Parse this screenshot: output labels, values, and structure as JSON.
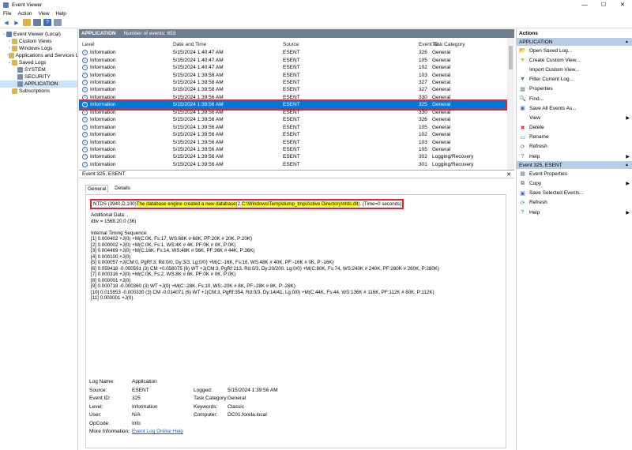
{
  "window": {
    "title": "Event Viewer",
    "controls": [
      "—",
      "☐",
      "✕"
    ]
  },
  "menu": [
    "File",
    "Action",
    "View",
    "Help"
  ],
  "tree": [
    {
      "label": "Event Viewer (Local)",
      "level": 0,
      "arrow": "⌄",
      "color": "#5a7fb5"
    },
    {
      "label": "Custom Views",
      "level": 1,
      "arrow": "›",
      "color": "#d8b44a"
    },
    {
      "label": "Windows Logs",
      "level": 1,
      "arrow": "›",
      "color": "#d8b44a"
    },
    {
      "label": "Applications and Services Lo",
      "level": 1,
      "arrow": "›",
      "color": "#d8b44a"
    },
    {
      "label": "Saved Logs",
      "level": 1,
      "arrow": "⌄",
      "color": "#d8b44a"
    },
    {
      "label": "SYSTEM",
      "level": 2,
      "arrow": "",
      "color": "#7a8fa6"
    },
    {
      "label": "SECURITY",
      "level": 2,
      "arrow": "",
      "color": "#7a8fa6"
    },
    {
      "label": "APPLICATION",
      "level": 2,
      "arrow": "",
      "color": "#7a8fa6",
      "selected": true
    },
    {
      "label": "Subscriptions",
      "level": 1,
      "arrow": "",
      "color": "#d8b44a"
    }
  ],
  "log": {
    "name": "APPLICATION",
    "count": "Number of events: 653"
  },
  "columns": {
    "level": "Level",
    "date": "Date and Time",
    "source": "Source",
    "id": "Event ID",
    "category": "Task Category"
  },
  "events": [
    {
      "level": "Information",
      "date": "5/15/2024 1:40:47 AM",
      "source": "ESENT",
      "id": "326",
      "category": "General"
    },
    {
      "level": "Information",
      "date": "5/15/2024 1:40:47 AM",
      "source": "ESENT",
      "id": "105",
      "category": "General"
    },
    {
      "level": "Information",
      "date": "5/15/2024 1:40:47 AM",
      "source": "ESENT",
      "id": "102",
      "category": "General"
    },
    {
      "level": "Information",
      "date": "5/15/2024 1:39:58 AM",
      "source": "ESENT",
      "id": "103",
      "category": "General"
    },
    {
      "level": "Information",
      "date": "5/15/2024 1:39:58 AM",
      "source": "ESENT",
      "id": "327",
      "category": "General"
    },
    {
      "level": "Information",
      "date": "5/15/2024 1:39:58 AM",
      "source": "ESENT",
      "id": "327",
      "category": "General"
    },
    {
      "level": "Information",
      "date": "5/15/2024 1:39:56 AM",
      "source": "ESENT",
      "id": "330",
      "category": "General"
    },
    {
      "level": "Information",
      "date": "5/15/2024 1:39:56 AM",
      "source": "ESENT",
      "id": "325",
      "category": "General",
      "selected": true
    },
    {
      "level": "Information",
      "date": "5/15/2024 1:39:56 AM",
      "source": "ESENT",
      "id": "330",
      "category": "General"
    },
    {
      "level": "Information",
      "date": "5/15/2024 1:39:56 AM",
      "source": "ESENT",
      "id": "326",
      "category": "General"
    },
    {
      "level": "Information",
      "date": "5/15/2024 1:39:56 AM",
      "source": "ESENT",
      "id": "105",
      "category": "General"
    },
    {
      "level": "Information",
      "date": "5/15/2024 1:39:56 AM",
      "source": "ESENT",
      "id": "102",
      "category": "General"
    },
    {
      "level": "Information",
      "date": "5/15/2024 1:39:56 AM",
      "source": "ESENT",
      "id": "103",
      "category": "General"
    },
    {
      "level": "Information",
      "date": "5/15/2024 1:39:56 AM",
      "source": "ESENT",
      "id": "105",
      "category": "General"
    },
    {
      "level": "Information",
      "date": "5/15/2024 1:39:56 AM",
      "source": "ESENT",
      "id": "302",
      "category": "Logging/Recovery"
    },
    {
      "level": "Information",
      "date": "5/15/2024 1:39:56 AM",
      "source": "ESENT",
      "id": "301",
      "category": "Logging/Recovery"
    }
  ],
  "detail": {
    "header": "Event 325, ESENT",
    "tabs": [
      "General",
      "Details"
    ],
    "msg_prefix": "NTDS (3940,D,100) ",
    "msg_hl1": "The database engine created a new database",
    "msg_mid": " (2, ",
    "msg_hl2": "C:\\Windows\\Temp\\dump_tmp\\Active Directory\\ntds.dit",
    "msg_suffix": "). (Time=0 seconds)",
    "lines": [
      "Additional Data: ,",
      "dbv = 1568.20.0 (36)",
      "",
      "Internal Timing Sequence:",
      "[1] 0.000402 +J(0) +M(C:0K, Fs:17, WS:68K # 68K, PF:20K # 20K, P:20K)",
      "[2] 0.000002 +J(0) +M(C:0K, Fs:1, WS:4K # 4K, PF:0K # 0K, P:0K)",
      "[3] 0.004469 +J(0) +M(C:16K, Fs:14, WS:48K # 56K, PF:36K # 44K, P:36K)",
      "[4] 0.000100 +J(0)",
      "[5] 0.000057 +J(CM:0, PgRf:3, Rd:0/0, Dy:3/3, Lg:0/0) +M(C:-16K, Fs:16, WS:48K # 40K, PF:-16K # 0K, P:-16K)",
      "[6] 0.059418 -0.000591 (3) CM +0.058075 (6) WT +J(CM:3, PgRf:213, Rd:0/3, Dy:20/200, Lg:0/0) +M(C:80K, Fs:74, WS:240K # 240K, PF:280K # 260K, P:280K)",
      "[7] 0.000316 +J(0) +M(C:0K, Fs:2, WS:8K # 8K, PF:0K # 0K, P:0K)",
      "[8] 0.000001 +J(0)",
      "[9] 0.000718 -0.000360 (3) WT +J(0) +M(C:-28K, Fs:10, WS:-20K # 8K, PF:-28K # 8K, P:-28K)",
      "[10] 0.015953 -0.000330 (3) CM -0.014071 (6) WT +J(CM:3, PgRf:354, Rd:0/3, Dy:14/41, Lg:0/0) +M(C:44K, Fs:44, WS:136K # 116K, PF:112K # 80K, P:112K)",
      "[11] 0.000001 +J(0)."
    ],
    "props": {
      "log_name_l": "Log Name:",
      "log_name_v": "Application",
      "source_l": "Source:",
      "source_v": "ESENT",
      "logged_l": "Logged:",
      "logged_v": "5/15/2024 1:39:56 AM",
      "event_id_l": "Event ID:",
      "event_id_v": "325",
      "task_l": "Task Category:",
      "task_v": "General",
      "level_l": "Level:",
      "level_v": "Information",
      "keywords_l": "Keywords:",
      "keywords_v": "Classic",
      "user_l": "User:",
      "user_v": "N/A",
      "computer_l": "Computer:",
      "computer_v": "DC01.forela.local",
      "opcode_l": "OpCode:",
      "opcode_v": "Info",
      "more_l": "More Information:",
      "more_v": "Event Log Online Help"
    }
  },
  "actions": {
    "title": "Actions",
    "section1": "APPLICATION",
    "items1": [
      {
        "label": "Open Saved Log...",
        "icon": "📂",
        "color": "#d8b44a"
      },
      {
        "label": "Create Custom View...",
        "icon": "▼",
        "color": "#d8b44a"
      },
      {
        "label": "Import Custom View...",
        "icon": "",
        "color": ""
      },
      {
        "label": "Filter Current Log...",
        "icon": "▼",
        "color": "#3a6db5"
      },
      {
        "label": "Properties",
        "icon": "▦",
        "color": "#6a7f9a"
      },
      {
        "label": "Find...",
        "icon": "🔍",
        "color": "#444"
      },
      {
        "label": "Save All Events As...",
        "icon": "▣",
        "color": "#3a6db5"
      },
      {
        "label": "View",
        "icon": "",
        "color": "",
        "sub": "▶"
      },
      {
        "label": "Delete",
        "icon": "✖",
        "color": "#e0262f"
      },
      {
        "label": "Rename",
        "icon": "▭",
        "color": "#3a6db5"
      },
      {
        "label": "Refresh",
        "icon": "⟳",
        "color": "#2a9a3a"
      },
      {
        "label": "Help",
        "icon": "?",
        "color": "#3a6db5",
        "sub": "▶"
      }
    ],
    "section2": "Event 325, ESENT",
    "items2": [
      {
        "label": "Event Properties",
        "icon": "▦",
        "color": "#6a7f9a"
      },
      {
        "label": "Copy",
        "icon": "⧉",
        "color": "#555",
        "sub": "▶"
      },
      {
        "label": "Save Selected Events...",
        "icon": "▣",
        "color": "#3a6db5"
      },
      {
        "label": "Refresh",
        "icon": "⟳",
        "color": "#2a9a3a"
      },
      {
        "label": "Help",
        "icon": "?",
        "color": "#3a6db5",
        "sub": "▶"
      }
    ]
  }
}
